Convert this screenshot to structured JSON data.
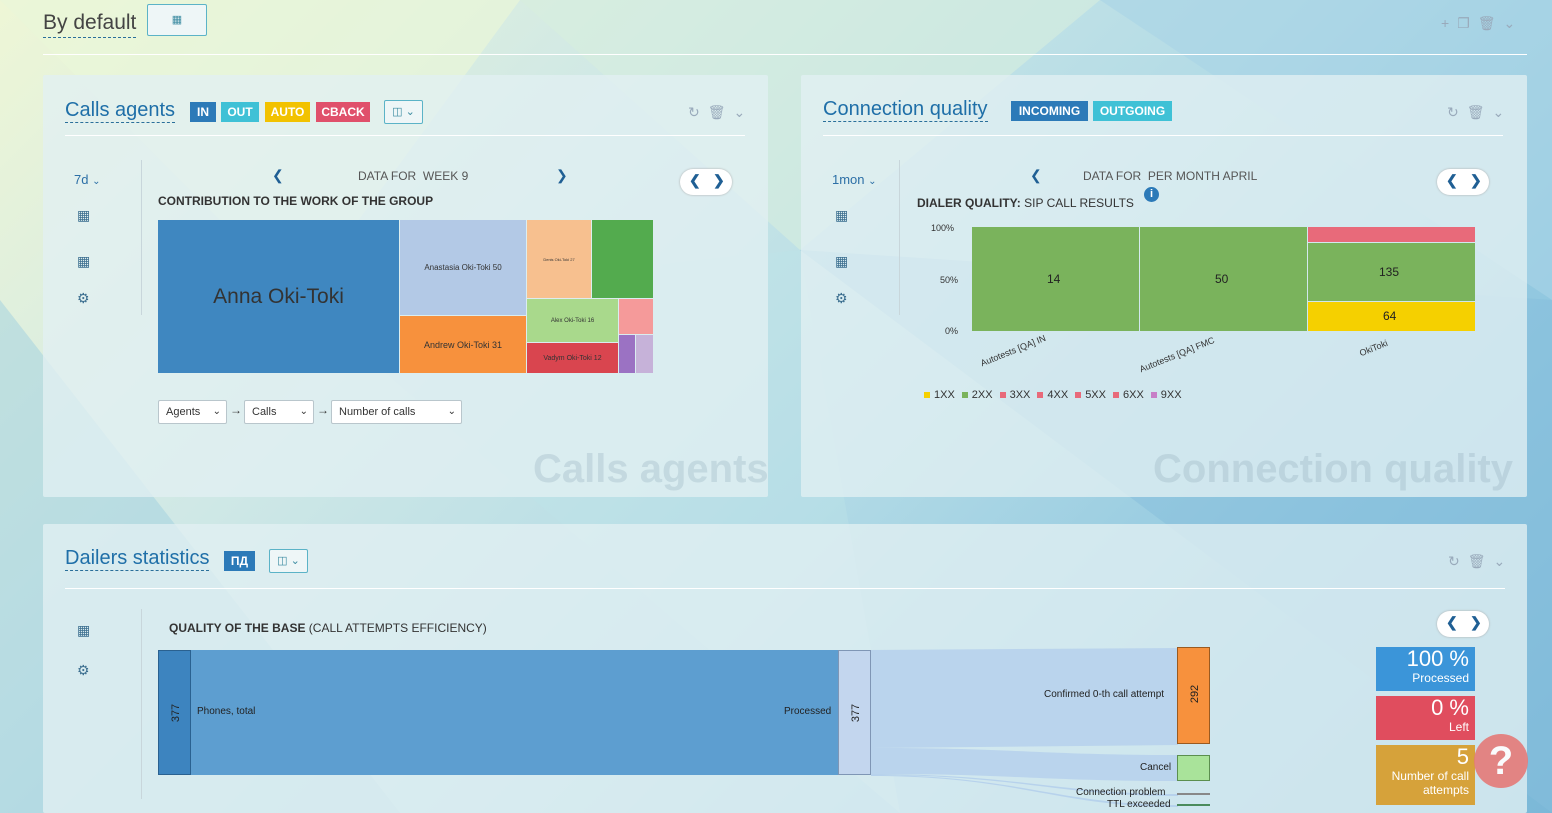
{
  "dashboard": {
    "title": "By default"
  },
  "calls_agents": {
    "title": "Calls agents",
    "badges": [
      {
        "label": "IN",
        "color": "#2c7ab8"
      },
      {
        "label": "OUT",
        "color": "#3fc1d6"
      },
      {
        "label": "AUTO",
        "color": "#f2c200"
      },
      {
        "label": "CBACK",
        "color": "#e0506b"
      }
    ],
    "period": "7d",
    "data_for": "DATA FOR",
    "period_label": "WEEK  9",
    "chart_title": "CONTRIBUTION TO THE WORK OF THE GROUP",
    "selects": [
      "Agents",
      "Calls",
      "Number of calls"
    ],
    "watermark": "Calls agents",
    "chart_data": {
      "type": "treemap",
      "title": "CONTRIBUTION TO THE WORK OF THE GROUP",
      "items": [
        {
          "label": "Anna Oki-Toki",
          "color": "#3f87c0"
        },
        {
          "label": "Anastasia Oki-Toki 50",
          "value": 50,
          "color": "#b3c9e6"
        },
        {
          "label": "Andrew Oki-Toki 31",
          "value": 31,
          "color": "#f7913d"
        },
        {
          "label": "Denis Oki-Toki 27",
          "value": 27,
          "color": "#f7c08f"
        },
        {
          "label": "",
          "color": "#53ab4e"
        },
        {
          "label": "Alex Oki-Toki 16",
          "value": 16,
          "color": "#a9d98c"
        },
        {
          "label": "",
          "color": "#f59a9a"
        },
        {
          "label": "Vadym Oki-Toki 12",
          "value": 12,
          "color": "#d9454f"
        },
        {
          "label": "",
          "color": "#9b72c3"
        },
        {
          "label": "",
          "color": "#c6b2d9"
        }
      ]
    }
  },
  "connection_quality": {
    "title": "Connection quality",
    "badges": [
      {
        "label": "INCOMING",
        "color": "#2c7ab8"
      },
      {
        "label": "OUTGOING",
        "color": "#3fc1d6"
      }
    ],
    "period": "1mon",
    "data_for": "DATA FOR",
    "period_label": "PER MONTH  APRIL",
    "chart_title_bold": "DIALER QUALITY:",
    "chart_title_rest": " SIP CALL RESULTS",
    "watermark": "Connection quality",
    "chart_data": {
      "type": "bar",
      "stacked": "percent",
      "categories": [
        "Autotests [QA] IN",
        "Autotests [QA] FMC",
        "OkiToki"
      ],
      "yticks": [
        "100%",
        "50%",
        "0%"
      ],
      "series": [
        {
          "name": "1XX",
          "color": "#f5d000",
          "values": [
            0,
            0,
            64
          ]
        },
        {
          "name": "2XX",
          "color": "#7ab35c",
          "values": [
            14,
            50,
            135
          ]
        },
        {
          "name": "3XX",
          "color": "#e86a7a",
          "values": [
            0,
            0,
            0
          ]
        },
        {
          "name": "4XX",
          "color": "#e86a7a",
          "values": [
            0,
            0,
            0
          ]
        },
        {
          "name": "5XX",
          "color": "#e86a7a",
          "values": [
            0,
            0,
            18
          ]
        },
        {
          "name": "6XX",
          "color": "#e86a7a",
          "values": [
            0,
            0,
            0
          ]
        },
        {
          "name": "9XX",
          "color": "#c77fc7",
          "values": [
            0,
            0,
            0
          ]
        }
      ],
      "data_labels": [
        [
          "14"
        ],
        [
          "50"
        ],
        [
          "135",
          "64"
        ]
      ]
    }
  },
  "dialers": {
    "title": "Dailers statistics",
    "badge": "ПД",
    "chart_title_bold": "QUALITY OF THE BASE",
    "chart_title_rest": " (CALL ATTEMPTS EFFICIENCY)",
    "chart_data": {
      "type": "sankey",
      "nodes": [
        {
          "label": "Phones, total",
          "value": 377
        },
        {
          "label": "Processed",
          "value": 377
        },
        {
          "label": "Confirmed 0-th call attempt",
          "value": 292
        },
        {
          "label": "Cancel"
        },
        {
          "label": "Connection problem"
        },
        {
          "label": "TTL exceeded"
        }
      ]
    },
    "kpis": [
      {
        "value": "100 %",
        "label": "Processed",
        "color": "#3b95d9"
      },
      {
        "value": "0 %",
        "label": "Left",
        "color": "#e04d5e"
      },
      {
        "value": "5",
        "label": "Number of call attempts",
        "color": "#d6a23a"
      }
    ]
  }
}
